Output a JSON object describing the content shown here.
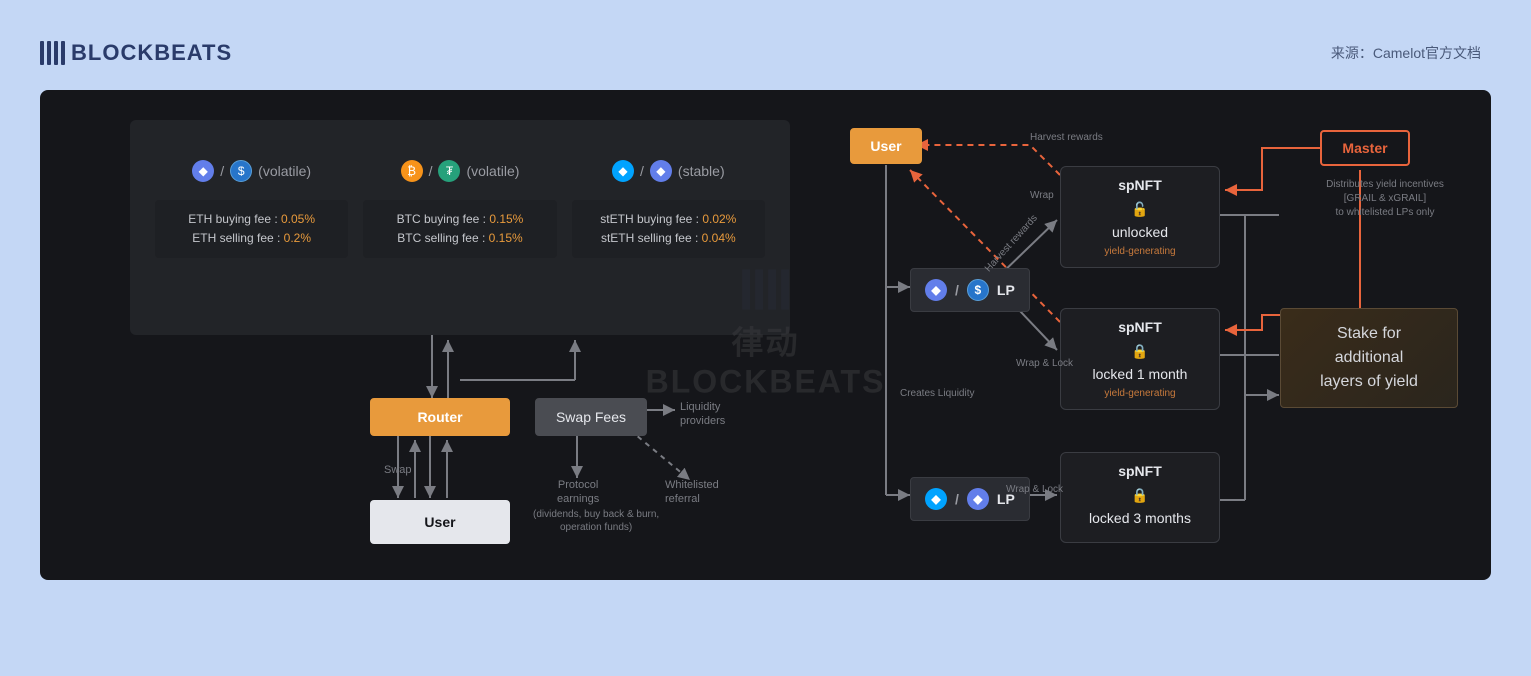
{
  "header": {
    "logo_text": "BLOCKBEATS",
    "source": "来源：Camelot官方文档"
  },
  "watermark": {
    "text1": "律动",
    "text2": "BLOCKBEATS"
  },
  "fees": {
    "col1": {
      "pair_type": "(volatile)",
      "line1": "ETH buying fee : ",
      "val1": "0.05%",
      "line2": "ETH selling fee : ",
      "val2": "0.2%"
    },
    "col2": {
      "pair_type": "(volatile)",
      "line1": "BTC buying fee : ",
      "val1": "0.15%",
      "line2": "BTC selling fee : ",
      "val2": "0.15%"
    },
    "col3": {
      "pair_type": "(stable)",
      "line1": "stETH buying fee : ",
      "val1": "0.02%",
      "line2": "stETH selling fee : ",
      "val2": "0.04%"
    }
  },
  "left": {
    "router": "Router",
    "swap_fees": "Swap Fees",
    "user": "User",
    "swap_lbl": "Swap",
    "liquidity_providers": "Liquidity\nproviders",
    "whitelisted_referral": "Whitelisted\nreferral",
    "protocol_earnings": "Protocol\nearnings",
    "protocol_sub": "(dividends, buy back & burn,\noperation funds)"
  },
  "right": {
    "user": "User",
    "master": "Master",
    "lp": "LP",
    "stake": "Stake for additional\nlayers of yield",
    "harvest": "Harvest rewards",
    "harvest2": "Harvest rewards",
    "wrap": "Wrap",
    "wrap_lock": "Wrap & Lock",
    "wrap_lock2": "Wrap & Lock",
    "creates_liquidity": "Creates Liquidity",
    "master_note": "Distributes yield incentives\n[GRAIL & xGRAIL]\nto whitelisted LPs only",
    "sp1": {
      "title": "spNFT",
      "status": "unlocked",
      "gen": "yield-generating"
    },
    "sp2": {
      "title": "spNFT",
      "status": "locked 1 month",
      "gen": "yield-generating"
    },
    "sp3": {
      "title": "spNFT",
      "status": "locked 3 months"
    }
  }
}
